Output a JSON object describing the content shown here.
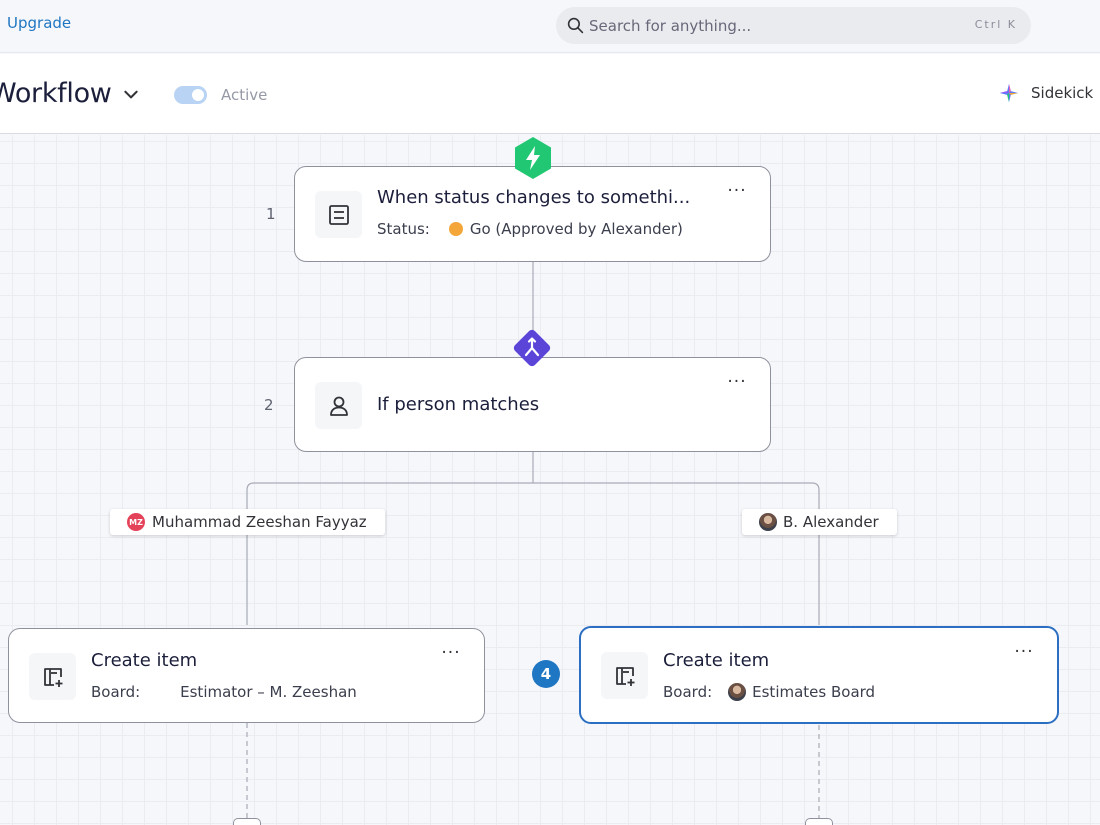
{
  "topbar": {
    "upgrade_label": "Upgrade",
    "search_placeholder": "Search for anything...",
    "search_shortcut": "Ctrl K"
  },
  "header": {
    "title": "Workflow",
    "toggle_state": "on",
    "active_label": "Active",
    "sidekick_label": "Sidekick"
  },
  "workflow": {
    "steps": [
      {
        "number": "1",
        "title": "When status changes to somethi...",
        "sub_label": "Status:",
        "sub_value": "Go (Approved by Alexander)",
        "status_color": "#f5a638",
        "icon": "table-icon",
        "badge_icon": "lightning-icon",
        "badge_color": "#22c773"
      },
      {
        "number": "2",
        "title": "If person matches",
        "icon": "person-icon",
        "badge_icon": "branch-icon",
        "badge_color": "#5b44d8"
      }
    ],
    "branches": [
      {
        "person": "Muhammad Zeeshan Fayyaz",
        "avatar_initials": "MZ",
        "avatar_color": "#e44258",
        "action": {
          "title": "Create item",
          "sub_label": "Board:",
          "sub_value": "Estimator – M. Zeeshan",
          "icon": "create-item-icon"
        }
      },
      {
        "person": "B. Alexander",
        "avatar": "photo",
        "step_number": "4",
        "selected": true,
        "action": {
          "title": "Create item",
          "sub_label": "Board:",
          "sub_value": "Estimates Board",
          "icon": "create-item-icon"
        }
      }
    ],
    "more_label": "···"
  },
  "colors": {
    "accent": "#1f76c2",
    "selected_border": "#2c6fc2"
  }
}
